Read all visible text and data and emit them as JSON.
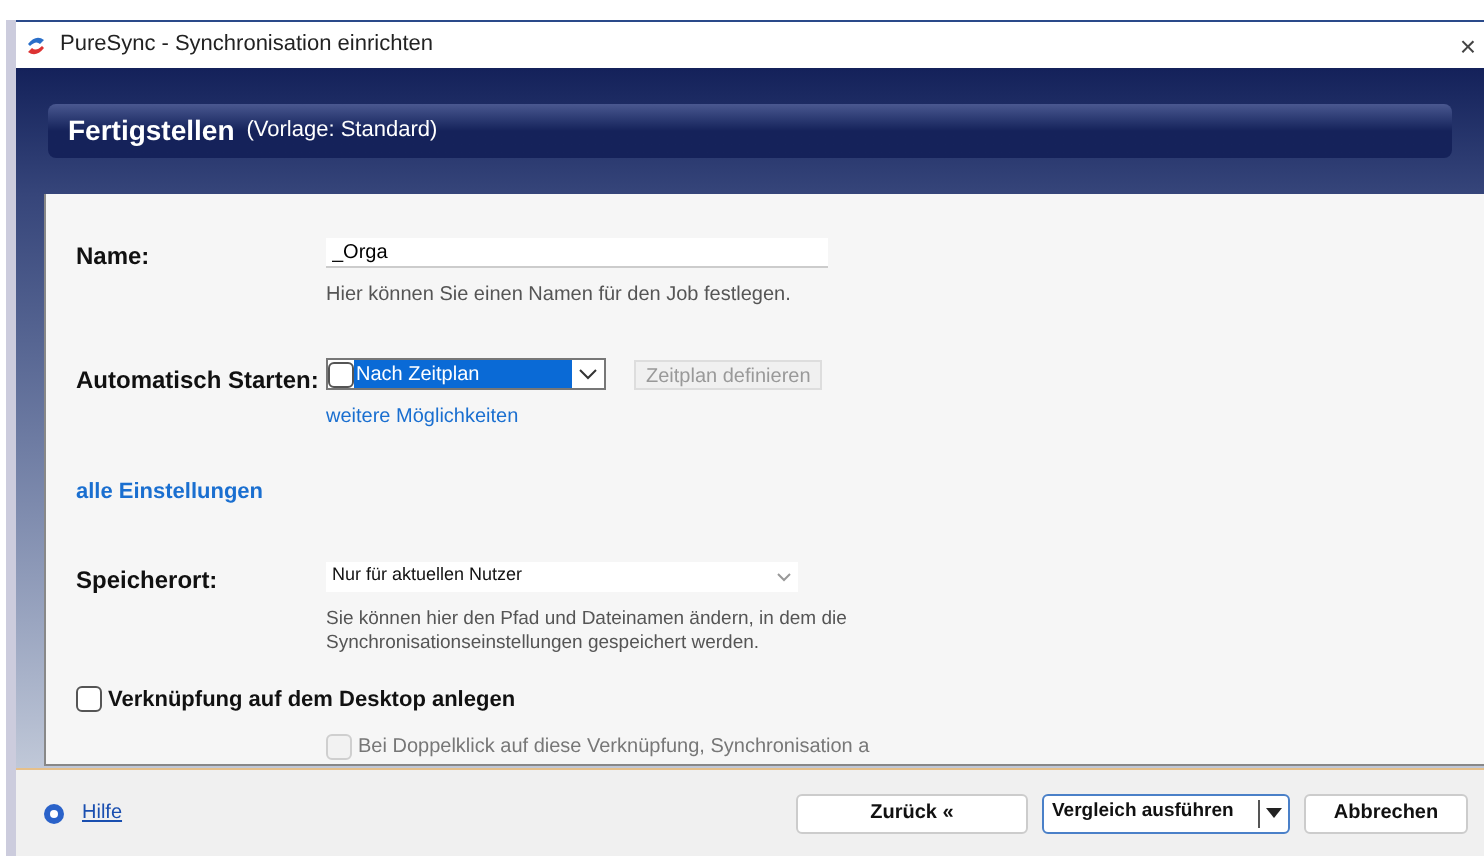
{
  "window": {
    "title": "PureSync - Synchronisation einrichten",
    "close": "×"
  },
  "header": {
    "title": "Fertigstellen",
    "subtitle": "(Vorlage: Standard)"
  },
  "name_field": {
    "label": "Name:",
    "value": "_Orga",
    "hint": "Hier können Sie einen Namen für den Job festlegen."
  },
  "autostart": {
    "label": "Automatisch Starten:",
    "checked": false,
    "value": "Nach Zeitplan",
    "button": {
      "label": "Zeitplan definieren",
      "disabled": true
    },
    "link": "weitere Möglichkeiten"
  },
  "all_settings_link": "alle Einstellungen",
  "storage": {
    "label": "Speicherort:",
    "value": "Nur für aktuellen Nutzer",
    "hint": "Sie können hier den Pfad und Dateinamen ändern, in dem die Synchronisationseinstellungen gespeichert werden."
  },
  "desktop_shortcut": {
    "label": "Verknüpfung auf dem Desktop anlegen",
    "checked": false
  },
  "sub_options": [
    {
      "label": "Bei Doppelklick auf diese Verknüpfung, Synchronisation a",
      "checked": false,
      "disabled": true
    }
  ],
  "footer": {
    "help": "Hilfe",
    "buttons": [
      {
        "label": "Zurück «",
        "kind": "plain",
        "focused": false
      },
      {
        "label": "Vergleich ausführen",
        "kind": "split",
        "focused": true
      },
      {
        "label": "Abbrechen",
        "kind": "plain",
        "focused": false
      }
    ]
  }
}
